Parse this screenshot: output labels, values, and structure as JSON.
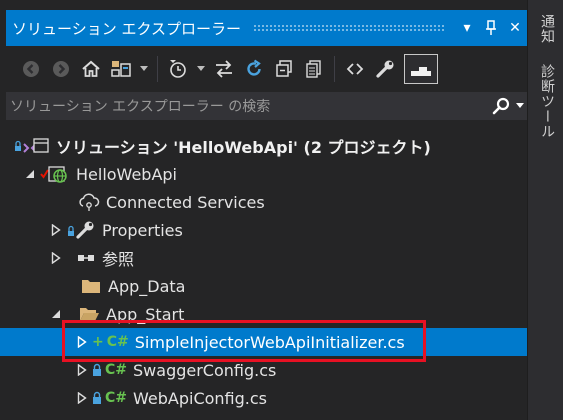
{
  "title_bar": {
    "title": "ソリューション エクスプローラー",
    "dropdown_glyph": "▾",
    "pin_icon": "pin-icon",
    "close_glyph": "✕"
  },
  "toolbar": {
    "icons": [
      "back-icon",
      "forward-icon",
      "home-icon",
      "switch-views-icon",
      "dropdown-icon",
      "pending-changes-filter-icon",
      "dropdown-icon",
      "sync-with-active-document-icon",
      "refresh-icon",
      "collapse-all-icon",
      "show-all-files-icon",
      "code-view-icon",
      "properties-icon",
      "preview-selected-items-icon"
    ]
  },
  "search": {
    "placeholder": "ソリューション エクスプローラー の検索"
  },
  "tree": {
    "items": [
      {
        "label": "ソリューション 'HelloWebApi' (2 プロジェクト)"
      },
      {
        "label": "HelloWebApi"
      },
      {
        "label": "Connected Services"
      },
      {
        "label": "Properties"
      },
      {
        "label": "参照"
      },
      {
        "label": "App_Data"
      },
      {
        "label": "App_Start"
      },
      {
        "label": "SimpleInjectorWebApiInitializer.cs"
      },
      {
        "label": "SwaggerConfig.cs"
      },
      {
        "label": "WebApiConfig.cs"
      }
    ],
    "csharp_badge": "C#"
  },
  "side_tabs": [
    "通知",
    "診断ツール"
  ],
  "colors": {
    "accent": "#007acc",
    "background": "#252526",
    "highlight_box": "#e81123",
    "folder": "#dcb67a",
    "csharp": "#68c250",
    "lock": "#4aa3df",
    "git_check": "#e51400"
  }
}
